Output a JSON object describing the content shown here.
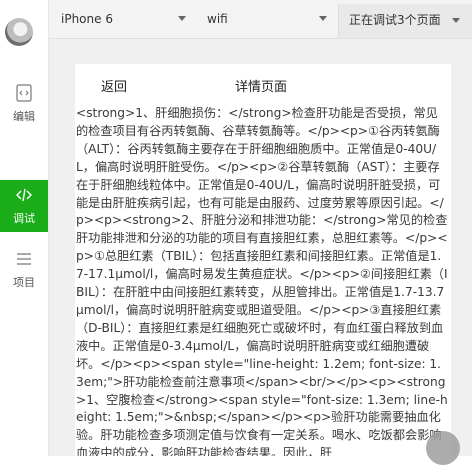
{
  "sidebar": {
    "items": [
      {
        "label": "编辑",
        "icon": "code-file-icon"
      },
      {
        "label": "调试",
        "icon": "code-icon"
      },
      {
        "label": "项目",
        "icon": "list-icon"
      }
    ]
  },
  "toolbar": {
    "device": "iPhone 6",
    "network": "wifi",
    "debug_pages": "正在调试3个页面"
  },
  "page": {
    "nav_back": "返回",
    "nav_title": "详情页面",
    "body_text": "<strong>1、肝细胞损伤：</strong>检查肝功能是否受损，常见的检查项目有谷丙转氨酶、谷草转氨酶等。</p><p>①谷丙转氨酶（ALT）：谷丙转氨酶主要存在于肝细胞细胞质中。正常值是0-40U/L，偏高时说明肝脏受伤。</p><p>②谷草转氨酶（AST）：主要存在于肝细胞线粒体中。正常值是0-40U/L，偏高时说明肝脏受损，可能是由肝脏疾病引起，也有可能是由服药、过度劳累等原因引起。</p><p><strong>2、肝脏分泌和排泄功能：</strong>常见的检查肝功能排泄和分泌的功能的项目有直接胆红素，总胆红素等。</p><p>①总胆红素（TBIL）：包括直接胆红素和间接胆红素。正常值是1.7-17.1μmol/l，偏高时易发生黄疸症状。</p><p>②间接胆红素（IBIL）：在肝脏中由间接胆红素转变，从胆管排出。正常值是1.7-13.7μmol/l，偏高时说明肝脏病变或胆道受阻。</p><p>③直接胆红素（D-BIL）：直接胆红素是红细胞死亡或破坏时，有血红蛋白释放到血液中。正常值是0-3.4μmol/L，偏高时说明肝脏病变或红细胞遭破坏。</p><p><span style=\"line-height: 1.2em; font-size: 1.3em;\">肝功能检查前注意事项</span><br/></p><p><strong>1、空腹检查</strong><span style=\"font-size: 1.3em; line-height: 1.5em;\">&nbsp;</span></p><p>验肝功能需要抽血化验。肝功能检查多项测定值与饮食有一定关系。喝水、吃饭都会影响血液中的成分，影响肝功能检查结果。因此，肝"
  }
}
